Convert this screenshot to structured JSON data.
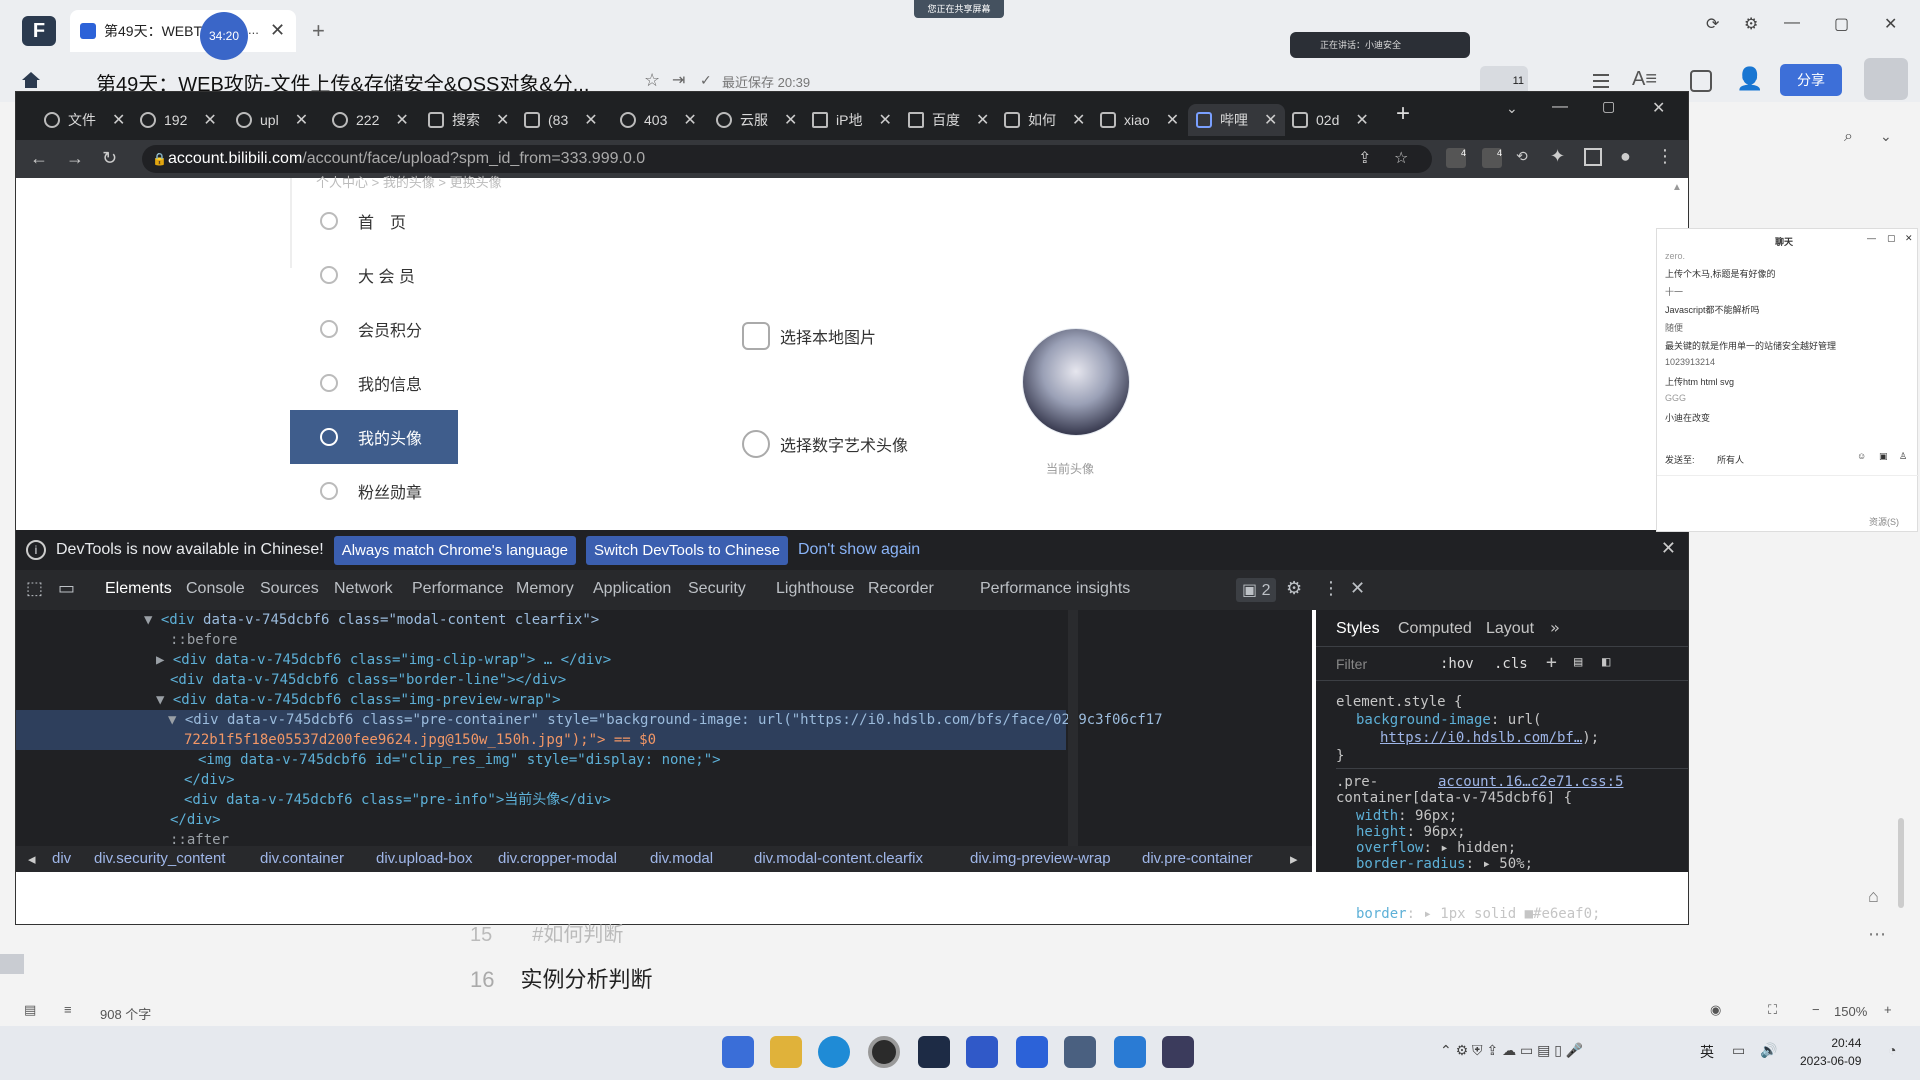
{
  "outer": {
    "tab_title": "第49天：WEBT",
    "timer": "34:20",
    "tab_suffix": "...",
    "sharing_banner": "您正在共享屏幕",
    "mic_text": "正在讲话：小迪安全",
    "doc_title": "第49天：WEB攻防-文件上传&存储安全&OSS对象&分...",
    "saved_label": "最近保存 20:39",
    "badge_count": "11",
    "share_label": "分享"
  },
  "browser": {
    "tabs": [
      {
        "label": "文件"
      },
      {
        "label": "192"
      },
      {
        "label": "upl"
      },
      {
        "label": "222"
      },
      {
        "label": "搜索"
      },
      {
        "label": "(83"
      },
      {
        "label": "403"
      },
      {
        "label": "云服"
      },
      {
        "label": "iP地"
      },
      {
        "label": "百度"
      },
      {
        "label": "如何"
      },
      {
        "label": "xiao"
      },
      {
        "label": "哔哩"
      },
      {
        "label": "02d"
      }
    ],
    "url_host": "account.bilibili.com",
    "url_path": "/account/face/upload?spm_id_from=333.999.0.0",
    "bookmark_badges": [
      "4",
      "4"
    ]
  },
  "page": {
    "breadcrumb_partial": "个人中心 > 我的头像 > 更换头像",
    "sidebar": [
      {
        "label": "首　页"
      },
      {
        "label": "大 会 员"
      },
      {
        "label": "会员积分"
      },
      {
        "label": "我的信息"
      },
      {
        "label": "我的头像"
      },
      {
        "label": "粉丝勋章"
      }
    ],
    "option_local": "选择本地图片",
    "option_digital": "选择数字艺术头像",
    "avatar_caption": "当前头像"
  },
  "devtools": {
    "banner_text": "DevTools is now available in Chinese!",
    "btn_match": "Always match Chrome's language",
    "btn_switch": "Switch DevTools to Chinese",
    "btn_dismiss": "Don't show again",
    "tabs": [
      "Elements",
      "Console",
      "Sources",
      "Network",
      "Performance",
      "Memory",
      "Application",
      "Security",
      "Lighthouse",
      "Recorder",
      "Performance insights"
    ],
    "issues_count": "2",
    "code": {
      "l1_tag": "<div",
      "l1_rest": " data-v-745dcbf6 class=\"modal-content clearfix\">",
      "l2": "::before",
      "l3": "<div data-v-745dcbf6 class=\"img-clip-wrap\"> … </div>",
      "l4": "<div data-v-745dcbf6 class=\"border-line\"></div>",
      "l5": "<div data-v-745dcbf6 class=\"img-preview-wrap\">",
      "l6": "<div data-v-745dcbf6 class=\"pre-container\" style=\"background-image: url(\"https://i0.hdslb.com/bfs/face/02d9c3f06cf17",
      "l7": "722b1f5f18e05537d200fee9624.jpg@150w_150h.jpg\");\"> == $0",
      "l8": "<img data-v-745dcbf6 id=\"clip_res_img\" style=\"display: none;\">",
      "l9": "</div>",
      "l10": "<div data-v-745dcbf6 class=\"pre-info\">当前头像</div>",
      "l11": "</div>",
      "l12": "::after"
    },
    "breadcrumb": [
      "div",
      "div.security_content",
      "div.container",
      "div.upload-box",
      "div.cropper-modal",
      "div.modal",
      "div.modal-content.clearfix",
      "div.img-preview-wrap",
      "div.pre-container"
    ],
    "styles_tabs": [
      "Styles",
      "Computed",
      "Layout"
    ],
    "filter_placeholder": "Filter",
    "hov": ":hov",
    "cls": ".cls",
    "styles": {
      "element_style": "element.style {",
      "bg_prop": "background-image",
      "bg_fn": ": url(",
      "bg_link": "https://i0.hdslb.com/bf…",
      "bg_end": ");",
      "close": "}",
      "selector_a": ".pre-",
      "source_link": "account.16…c2e71.css:5",
      "selector_b": "container[data-v-745dcbf6] {",
      "rules": [
        {
          "prop": "width",
          "val": "96px;"
        },
        {
          "prop": "height",
          "val": "96px;"
        },
        {
          "prop": "overflow",
          "val": "▸ hidden;"
        },
        {
          "prop": "border-radius",
          "val": "▸ 50%;"
        },
        {
          "prop": "border",
          "val": "▸ 1px solid ■#e6eaf0;"
        }
      ]
    }
  },
  "chat": {
    "title": "聊天",
    "lines": [
      "zero.",
      "上传个木马,标题是有好像的",
      "十一",
      "Javascript都不能解析吗",
      "随便",
      "最关键的就是作用单一的站储安全越好管理",
      "1023913214",
      "上传htm html svg",
      "GGG",
      "小迪在改变"
    ],
    "send_to_label": "发送至:",
    "send_to_value": "所有人",
    "resource_label": "资源(S)"
  },
  "document": {
    "line15_num": "15",
    "line15_text": "#如何判断",
    "line16_num": "16",
    "line16_text": "实例分析判断"
  },
  "statusbar": {
    "word_count": "908 个字",
    "zoom": "150%"
  },
  "taskbar": {
    "ime": "英",
    "time": "20:44",
    "date": "2023-06-09"
  }
}
